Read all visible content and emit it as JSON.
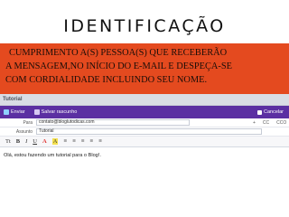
{
  "slide": {
    "title": "IDENTIFICAÇÃO",
    "banner_lines": [
      "CUMPRIMENTO A(S) PESSOA(S) QUE RECEBERÃO",
      "A MENSAGEM,NO INÍCIO DO E-MAIL E DESPEÇA-SE",
      "COM CORDIALIDADE INCLUINDO SEU NOME."
    ],
    "banner_color": "#e44a1f"
  },
  "email": {
    "window_title": "Tutorial",
    "toolbar": {
      "send_label": "Enviar",
      "save_label": "Salvar rascunho",
      "cancel_label": "Cancelar",
      "accent": "#5b2fa2"
    },
    "to_label": "Para",
    "to_value": "contato@bloglutodicas.com",
    "cc_label": "CC",
    "bcc_label": "CCO",
    "subject_label": "Assunto",
    "subject_value": "Tutorial",
    "format_buttons": [
      "Tt",
      "B",
      "I",
      "U",
      "A",
      "A",
      "≡",
      "≡",
      "≡",
      "≡",
      "≡"
    ],
    "body": "Olá, estou fazendo um tutorial para o Blog!."
  }
}
